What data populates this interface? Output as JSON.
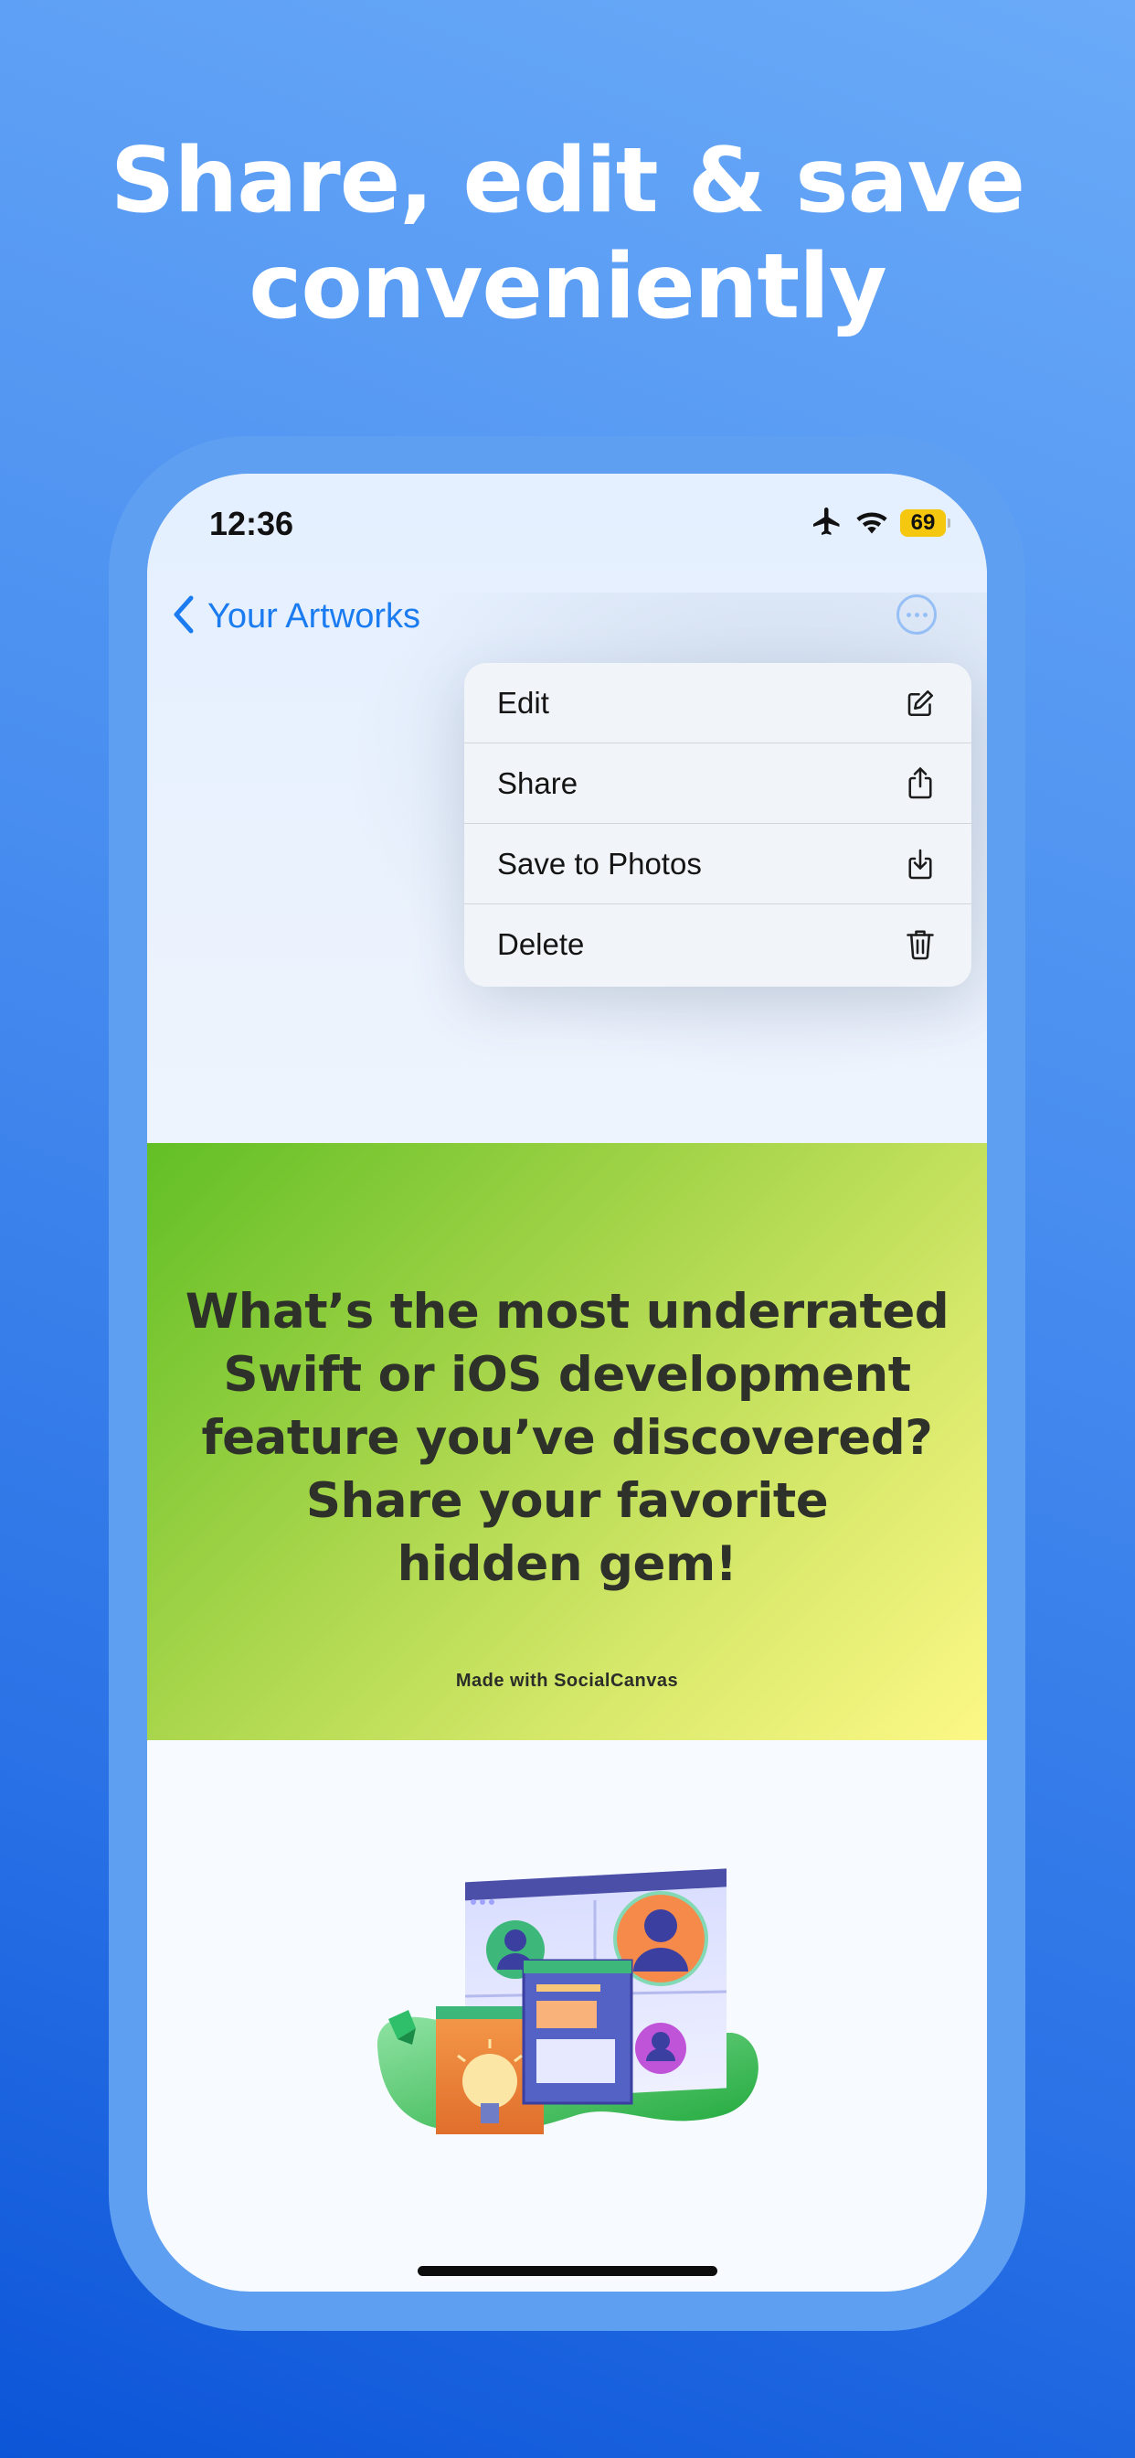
{
  "headline": {
    "line1": "Share, edit & save",
    "line2": "conveniently"
  },
  "status_bar": {
    "time": "12:36",
    "battery": "69"
  },
  "nav": {
    "back_label": "Your Artworks"
  },
  "menu": {
    "items": [
      {
        "label": "Edit",
        "icon": "compose-icon"
      },
      {
        "label": "Share",
        "icon": "share-icon"
      },
      {
        "label": "Save to Photos",
        "icon": "download-icon"
      },
      {
        "label": "Delete",
        "icon": "trash-icon"
      }
    ]
  },
  "artwork": {
    "lines": [
      "What’s the most underrated",
      "Swift or iOS development",
      "feature you’ve discovered?",
      "Share your favorite",
      "hidden gem!"
    ],
    "credit": "Made with SocialCanvas"
  },
  "colors": {
    "background": "#4a8ff0",
    "accent": "#1a7cf0",
    "battery": "#f5c70f",
    "artwork_start": "#62bf25",
    "artwork_end": "#fdf886"
  }
}
